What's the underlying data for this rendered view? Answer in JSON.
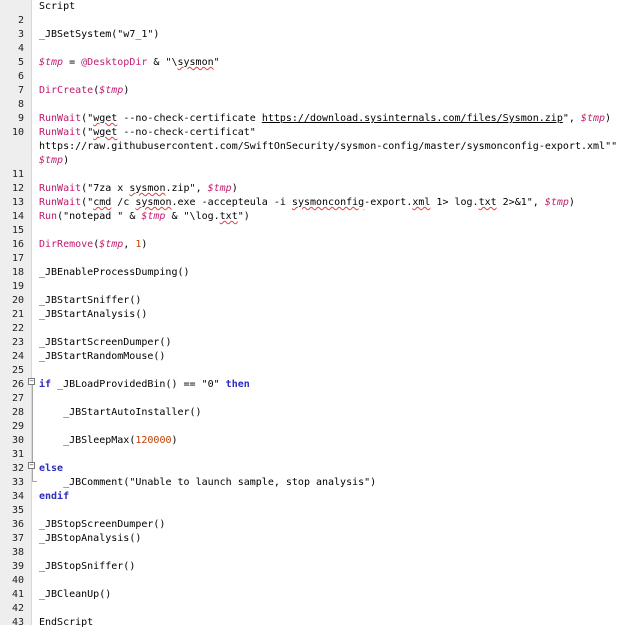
{
  "editor": {
    "lines": [
      {
        "n": "",
        "t": "Script"
      },
      {
        "n": "2",
        "t": ""
      },
      {
        "n": "3",
        "t": "_JBSetSystem(\"w7_1\")"
      },
      {
        "n": "4",
        "t": ""
      },
      {
        "n": "5",
        "t": "$tmp = @DesktopDir & \"\\sysmon\""
      },
      {
        "n": "6",
        "t": ""
      },
      {
        "n": "7",
        "t": "DirCreate($tmp)"
      },
      {
        "n": "8",
        "t": ""
      },
      {
        "n": "9",
        "t": "RunWait(\"wget --no-check-certificate https://download.sysinternals.com/files/Sysmon.zip\", $tmp)"
      },
      {
        "n": "10",
        "t": "RunWait(\"wget --no-check-certificate"
      },
      {
        "n": "",
        "t": "https://raw.githubusercontent.com/SwiftOnSecurity/sysmon-config/master/sysmonconfig-export.xml\","
      },
      {
        "n": "",
        "t": "$tmp)"
      },
      {
        "n": "11",
        "t": ""
      },
      {
        "n": "12",
        "t": "RunWait(\"7za x sysmon.zip\", $tmp)"
      },
      {
        "n": "13",
        "t": "RunWait(\"cmd /c sysmon.exe -accepteula -i sysmonconfig-export.xml 1> log.txt 2>&1\", $tmp)"
      },
      {
        "n": "14",
        "t": "Run(\"notepad \" & $tmp & \"\\log.txt\")"
      },
      {
        "n": "15",
        "t": ""
      },
      {
        "n": "16",
        "t": "DirRemove($tmp, 1)"
      },
      {
        "n": "17",
        "t": ""
      },
      {
        "n": "18",
        "t": "_JBEnableProcessDumping()"
      },
      {
        "n": "19",
        "t": ""
      },
      {
        "n": "20",
        "t": "_JBStartSniffer()"
      },
      {
        "n": "21",
        "t": "_JBStartAnalysis()"
      },
      {
        "n": "22",
        "t": ""
      },
      {
        "n": "23",
        "t": "_JBStartScreenDumper()"
      },
      {
        "n": "24",
        "t": "_JBStartRandomMouse()"
      },
      {
        "n": "25",
        "t": ""
      },
      {
        "n": "26",
        "t": "if _JBLoadProvidedBin() == \"0\" then"
      },
      {
        "n": "27",
        "t": ""
      },
      {
        "n": "28",
        "t": "    _JBStartAutoInstaller()"
      },
      {
        "n": "29",
        "t": ""
      },
      {
        "n": "30",
        "t": "    _JBSleepMax(120000)"
      },
      {
        "n": "31",
        "t": ""
      },
      {
        "n": "32",
        "t": "else"
      },
      {
        "n": "33",
        "t": "    _JBComment(\"Unable to launch sample, stop analysis\")"
      },
      {
        "n": "34",
        "t": "endif"
      },
      {
        "n": "35",
        "t": ""
      },
      {
        "n": "36",
        "t": "_JBStopScreenDumper()"
      },
      {
        "n": "37",
        "t": "_JBStopAnalysis()"
      },
      {
        "n": "38",
        "t": ""
      },
      {
        "n": "39",
        "t": "_JBStopSniffer()"
      },
      {
        "n": "40",
        "t": ""
      },
      {
        "n": "41",
        "t": "_JBCleanUp()"
      },
      {
        "n": "42",
        "t": ""
      },
      {
        "n": "43",
        "t": "EndScript"
      }
    ]
  },
  "colors": {
    "gutter_bg": "#eeeeee",
    "keyword": "#2d2dbf",
    "builtin_func": "#c0176b",
    "variable": "#c02070",
    "string": "#7f7f7f",
    "number": "#c04000",
    "squiggle": "#e04040"
  },
  "icons": {
    "fold_open": "minus-box-icon"
  }
}
